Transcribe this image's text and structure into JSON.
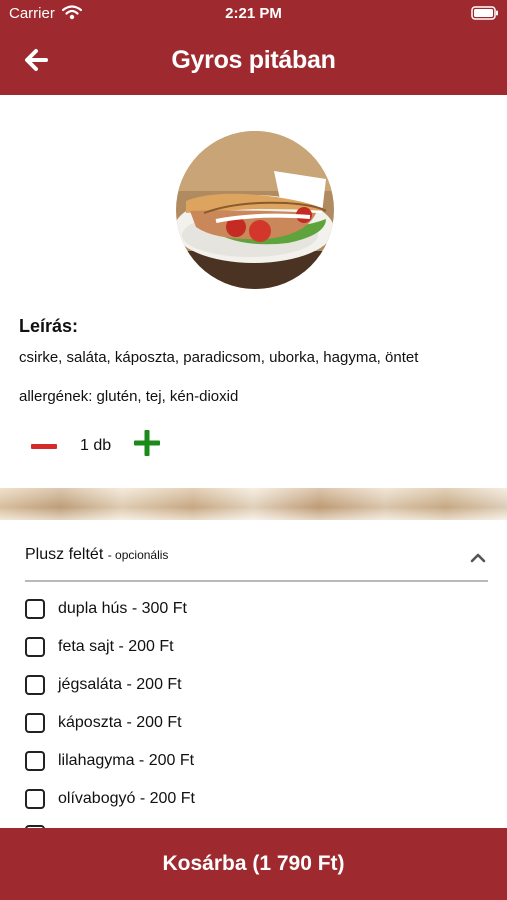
{
  "status_bar": {
    "carrier": "Carrier",
    "time": "2:21 PM"
  },
  "header": {
    "title": "Gyros pitában",
    "back_icon": "arrow-left-icon"
  },
  "product": {
    "image_alt": "gyros-pita-photo",
    "description_label": "Leírás:",
    "description": "csirke, saláta, káposzta, paradicsom, uborka, hagyma, öntet",
    "allergens": "allergének: glutén, tej, kén-dioxid"
  },
  "quantity": {
    "label": "1 db"
  },
  "toppings": {
    "title": "Plusz feltét",
    "subtitle": "- opcionális",
    "items": [
      {
        "label": "dupla hús - 300 Ft",
        "checked": false
      },
      {
        "label": "feta sajt - 200 Ft",
        "checked": false
      },
      {
        "label": "jégsaláta - 200 Ft",
        "checked": false
      },
      {
        "label": "káposzta - 200 Ft",
        "checked": false
      },
      {
        "label": "lilahagyma - 200 Ft",
        "checked": false
      },
      {
        "label": "olívabogyó - 200 Ft",
        "checked": false
      }
    ]
  },
  "cart": {
    "button_label": "Kosárba (1 790 Ft)"
  },
  "colors": {
    "brand": "#9e2a2f",
    "minus": "#d42a2a",
    "plus": "#1a8a1a"
  }
}
